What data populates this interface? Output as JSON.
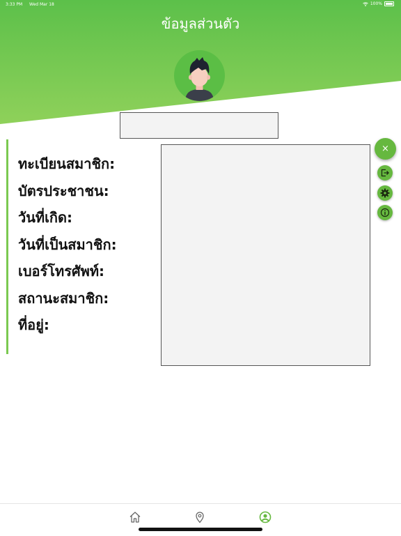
{
  "status_bar": {
    "time": "3:33 PM",
    "date": "Wed Mar 18",
    "battery": "100%"
  },
  "header": {
    "title": "ข้อมูลส่วนตัว"
  },
  "profile": {
    "labels": [
      "ทะเบียนสมาชิก:",
      "บัตรประชาชน:",
      "วันที่เกิด:",
      "วันที่เป็นสมาชิก:",
      "เบอร์โทรศัพท์:",
      "สถานะสมาชิก:",
      "ที่อยู่:"
    ]
  },
  "fab": {
    "close_symbol": "×",
    "actions": [
      "logout-icon",
      "gear-icon",
      "info-icon"
    ]
  },
  "tabs": [
    {
      "icon": "home-icon",
      "active": false
    },
    {
      "icon": "location-pin-icon",
      "active": false
    },
    {
      "icon": "user-circle-icon",
      "active": true
    }
  ],
  "colors": {
    "accent": "#66b83f",
    "header_top": "#5cc04a",
    "header_bottom": "#8fd15a",
    "text": "#111111"
  }
}
